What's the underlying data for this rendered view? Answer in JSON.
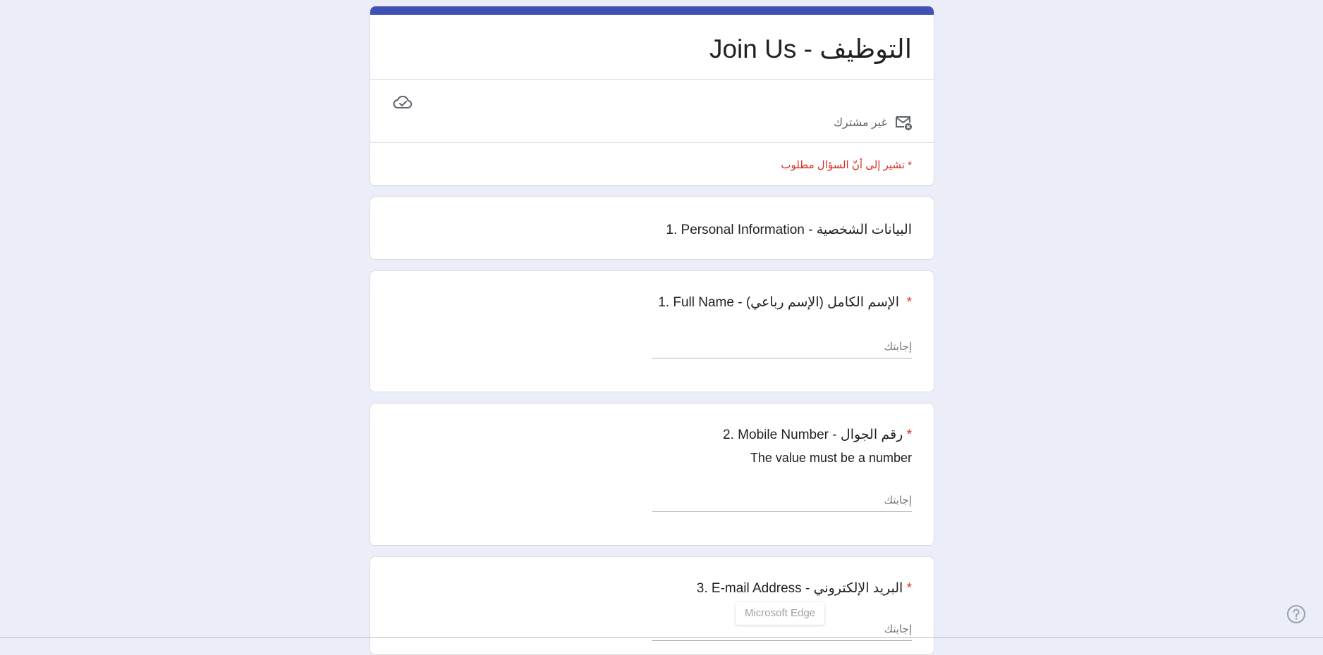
{
  "form": {
    "title": "التوظيف - Join Us",
    "account_status": "غير مشترك",
    "required_note": "* تشير إلى أنّ السؤال مطلوب"
  },
  "section": {
    "title": "1. Personal Information - البيانات الشخصية"
  },
  "questions": [
    {
      "number_label": "1. Full Name - الإسم الكامل (الإسم رباعي)",
      "required_mark": "*",
      "placeholder": "إجابتك"
    },
    {
      "number_label": "2. Mobile Number - رقم الجوال",
      "required_mark": "*",
      "description": "The value must be a number",
      "placeholder": "إجابتك"
    },
    {
      "number_label": "3. E-mail Address - البريد الإلكتروني",
      "required_mark": "*",
      "placeholder": "إجابتك"
    }
  ],
  "tooltip": {
    "text": "Microsoft Edge"
  },
  "icons": {
    "cloud": "cloud-saved-icon",
    "mail": "mail-not-shared-icon",
    "help": "help-circle-icon"
  },
  "colors": {
    "accent": "#3f51b5",
    "required": "#d93025",
    "background": "#ebedf8"
  }
}
